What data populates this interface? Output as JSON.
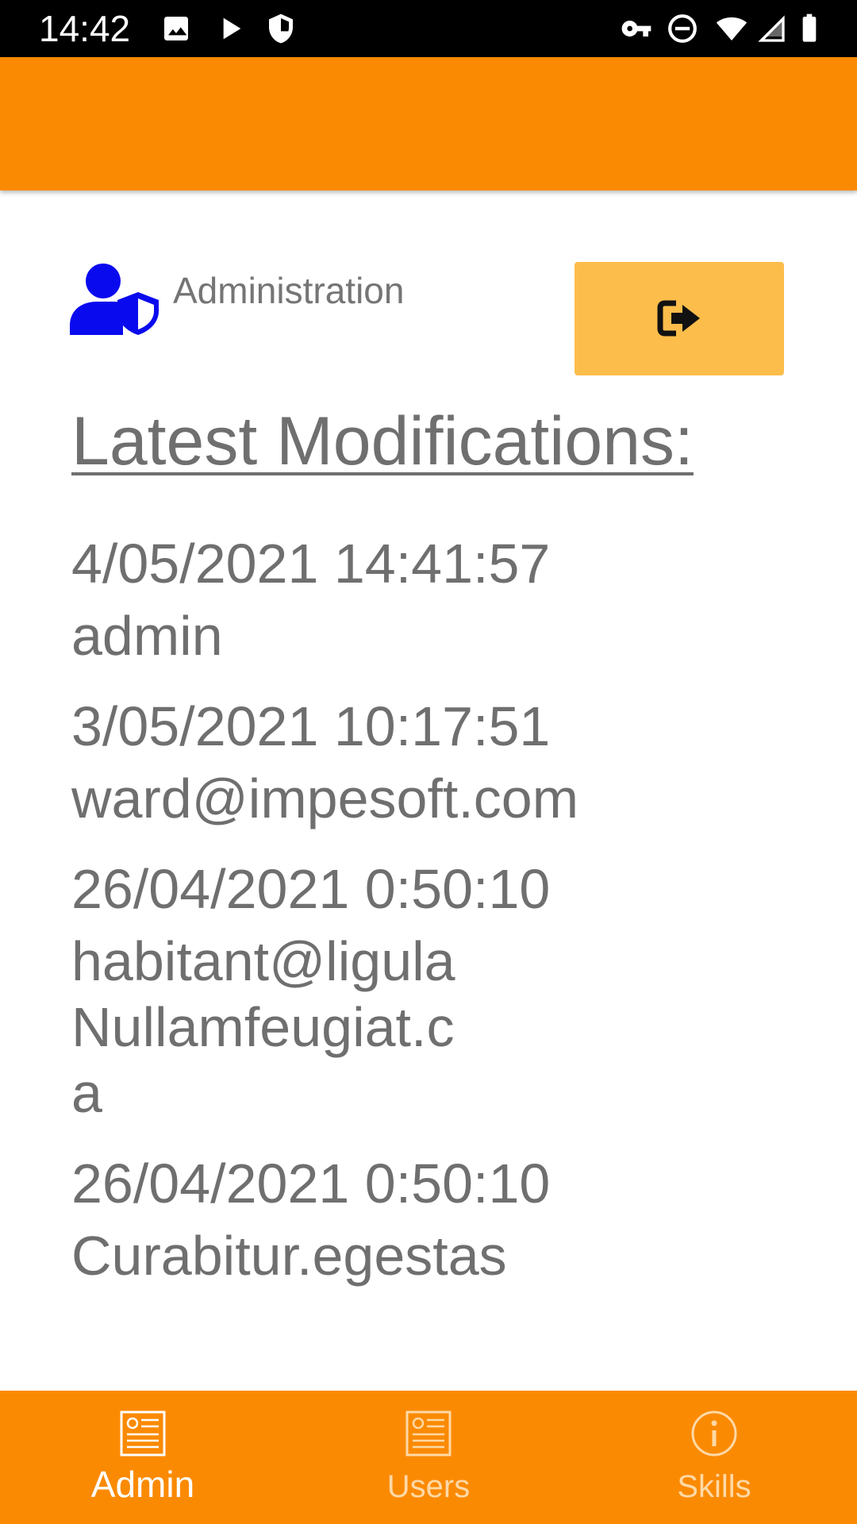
{
  "status_bar": {
    "time": "14:42",
    "icons_left": [
      "image-icon",
      "play-icon",
      "shield-icon"
    ],
    "icons_right": [
      "key-icon",
      "do-not-disturb-icon",
      "wifi-icon",
      "signal-icon",
      "battery-icon"
    ]
  },
  "colors": {
    "primary": "#fb8a03",
    "button": "#fdbd4b",
    "admin_icon": "#0a0aee",
    "text_gray": "#6f6f6f",
    "nav_inactive": "#ffd9a6"
  },
  "header": {
    "admin_icon": "user-shield-icon",
    "label": "Administration",
    "logout_icon": "sign-out-icon"
  },
  "main": {
    "title": "Latest Modifications:",
    "modifications": [
      {
        "date": "4/05/2021 14:41:57",
        "user": "admin"
      },
      {
        "date": "3/05/2021 10:17:51",
        "user": "ward@impesoft.com"
      },
      {
        "date": "26/04/2021 0:50:10",
        "user": "habitant@ligulaNullamfeugiat.ca"
      },
      {
        "date": "26/04/2021 0:50:10",
        "user": "Curabitur.egestas"
      }
    ]
  },
  "bottom_nav": {
    "items": [
      {
        "label": "Admin",
        "icon": "newspaper-icon",
        "active": true
      },
      {
        "label": "Users",
        "icon": "newspaper-icon",
        "active": false
      },
      {
        "label": "Skills",
        "icon": "info-icon",
        "active": false
      }
    ]
  }
}
